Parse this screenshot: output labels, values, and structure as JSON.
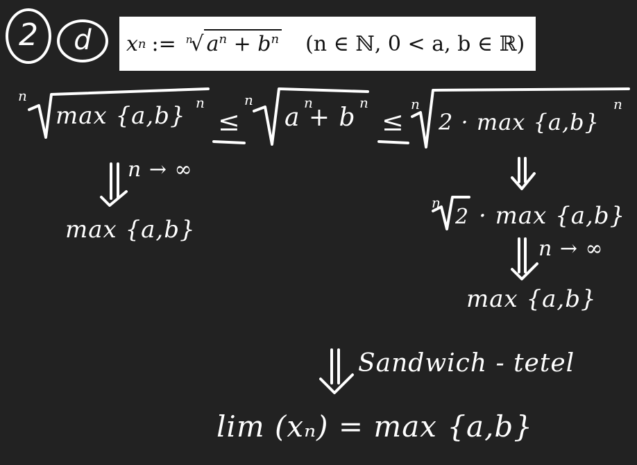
{
  "problem_marker": {
    "number": "2",
    "letter": "d"
  },
  "definition": {
    "lhs": "x",
    "lhs_sub": "n",
    "assign": ":=",
    "root_index": "n",
    "surd": "√",
    "radicand_a": "a",
    "radicand_b": "b",
    "exp": "n",
    "plus": "+",
    "condition": "(n ∈ ℕ,  0 < a, b ∈ ℝ)"
  },
  "inequality": {
    "left_index": "n",
    "left_radicand": "max {a,b}",
    "left_exp": "n",
    "leq1": "≤",
    "mid_index": "n",
    "mid_radicand": "a + b",
    "mid_exp_a": "n",
    "mid_exp_b": "n",
    "leq2": "≤",
    "right_index": "n",
    "right_radicand": "2 · max {a,b}",
    "right_exp": "n"
  },
  "left_branch": {
    "arrow_label": "n → ∞",
    "result": "max {a,b}"
  },
  "right_branch": {
    "step_index": "n",
    "step_radicand": "2",
    "step_rest": "· max {a,b}",
    "arrow_label": "n → ∞",
    "result": "max {a,b}"
  },
  "conclusion": {
    "arrow_label": "Sandwich - tetel",
    "result": "lim (xₙ) = max {a,b}"
  },
  "colors": {
    "background": "#222222",
    "ink": "#ffffff",
    "box": "#ffffff",
    "box_text": "#111111"
  }
}
